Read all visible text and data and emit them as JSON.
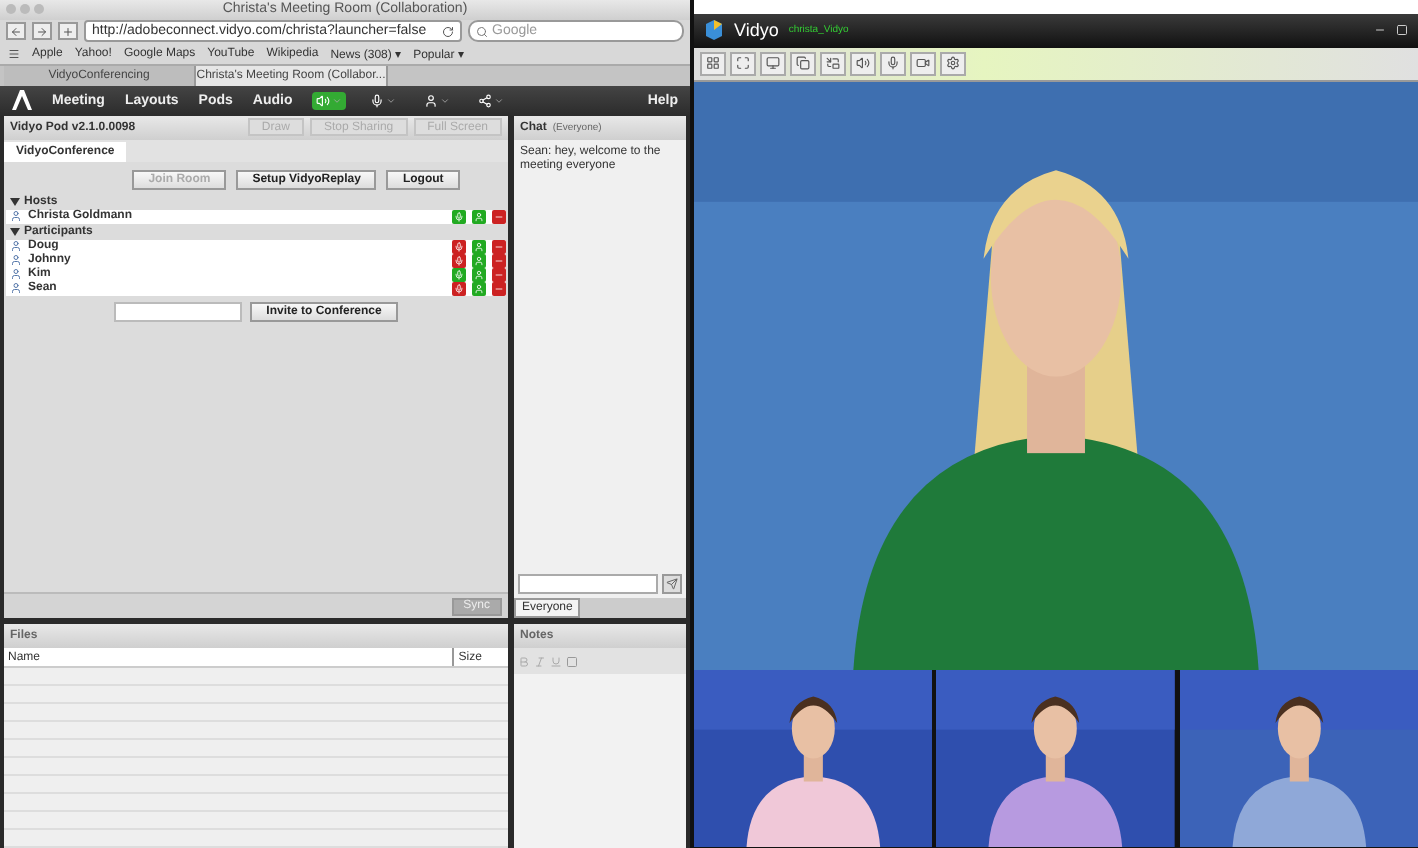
{
  "browser": {
    "title": "Christa's Meeting Room (Collaboration)",
    "url": "http://adobeconnect.vidyo.com/christa?launcher=false",
    "search_placeholder": "Google",
    "bookmarks": [
      "Apple",
      "Yahoo!",
      "Google Maps",
      "YouTube",
      "Wikipedia",
      "News (308) ▾",
      "Popular ▾"
    ],
    "tabs": [
      {
        "label": "VidyoConferencing",
        "selected": false
      },
      {
        "label": "Christa's Meeting Room (Collabor...",
        "selected": true
      }
    ]
  },
  "menu": {
    "items": [
      "Meeting",
      "Layouts",
      "Pods",
      "Audio"
    ],
    "help": "Help"
  },
  "pod": {
    "title": "Vidyo Pod v2.1.0.0098",
    "toolbar": [
      "Draw",
      "Stop Sharing",
      "Full Screen"
    ],
    "tab": "VidyoConference",
    "actions": [
      {
        "label": "Join Room",
        "disabled": true
      },
      {
        "label": "Setup VidyoReplay",
        "disabled": false
      },
      {
        "label": "Logout",
        "disabled": false
      }
    ],
    "sections": [
      {
        "title": "Hosts",
        "people": [
          {
            "name": "Christa Goldmann",
            "mic_on": true,
            "cam_on": true
          }
        ]
      },
      {
        "title": "Participants",
        "people": [
          {
            "name": "Doug",
            "mic_on": false,
            "cam_on": true
          },
          {
            "name": "Johnny",
            "mic_on": false,
            "cam_on": true
          },
          {
            "name": "Kim",
            "mic_on": true,
            "cam_on": true
          },
          {
            "name": "Sean",
            "mic_on": false,
            "cam_on": true
          }
        ]
      }
    ],
    "invite": "Invite to Conference",
    "sync": "Sync"
  },
  "chat": {
    "title": "Chat",
    "scope": "(Everyone)",
    "messages": [
      "Sean: hey, welcome to the meeting everyone"
    ],
    "tab": "Everyone"
  },
  "files": {
    "title": "Files",
    "columns": [
      "Name",
      "Size"
    ]
  },
  "notes": {
    "title": "Notes"
  },
  "vidyo": {
    "title": "Vidyo",
    "user": "christa_Vidyo"
  }
}
